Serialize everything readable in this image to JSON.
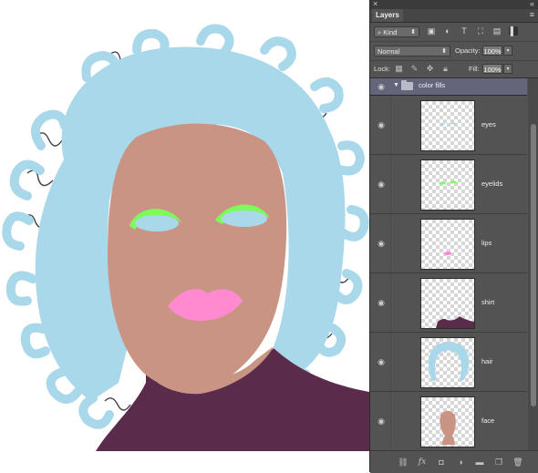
{
  "panel": {
    "close_glyph": "×",
    "collapse_glyph": "«",
    "tab_label": "Layers",
    "menu_glyph": "≡",
    "filter": {
      "kind_label": "Kind",
      "search_glyph": "⌕",
      "arrows_glyph": "⬍"
    },
    "blend": {
      "mode": "Normal",
      "opacity_label": "Opacity:",
      "opacity_value": "100%"
    },
    "lock": {
      "label": "Lock:",
      "fill_label": "Fill:",
      "fill_value": "100%"
    }
  },
  "layers": {
    "group": {
      "name": "color fills",
      "expand_glyph": "▼",
      "visible": true
    },
    "items": [
      {
        "name": "eyes",
        "visible": true
      },
      {
        "name": "eyelids",
        "visible": true
      },
      {
        "name": "lips",
        "visible": true
      },
      {
        "name": "shirt",
        "visible": true
      },
      {
        "name": "hair",
        "visible": true
      },
      {
        "name": "face",
        "visible": true
      }
    ]
  },
  "bottom_icons": [
    "link-icon",
    "fx-icon",
    "mask-icon",
    "adjustment-icon",
    "folder-icon",
    "new-layer-icon",
    "trash-icon"
  ],
  "bottom_fx_label": "fx",
  "colors": {
    "hair": "#a8d8ea",
    "face": "#c99483",
    "eyelids": "#7dfb5a",
    "lips": "#ff8ad0",
    "shirt": "#5b2b4c",
    "eyes": "#a8d8ea",
    "group_row": "#64657a",
    "panel_bg": "#535353"
  }
}
